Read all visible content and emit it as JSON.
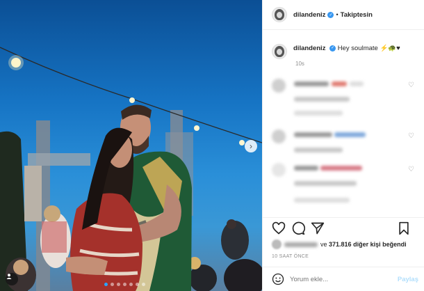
{
  "post": {
    "username": "dilandeniz",
    "follow_status": "Takiptesin",
    "dot": "•",
    "caption_text": "Hey soulmate",
    "caption_emojis": "⚡🐢♥",
    "caption_time": "10s",
    "likes_count": "371.816",
    "likes_prefix": "ve",
    "likes_suffix": "diğer kişi beğendi",
    "post_date": "10 SAAT ÖNCE",
    "comment_placeholder": "Yorum ekle...",
    "post_button": "Paylaş"
  },
  "colors": {
    "verified": "#3897f0",
    "link_disabled": "#b2dffc",
    "muted": "#8e8e8e"
  },
  "icons": {
    "like": "heart-icon",
    "comment": "comment-icon",
    "share": "send-icon",
    "save": "bookmark-icon",
    "emoji": "smiley-icon",
    "next": "chevron-right-icon",
    "tag": "person-tag-icon"
  }
}
